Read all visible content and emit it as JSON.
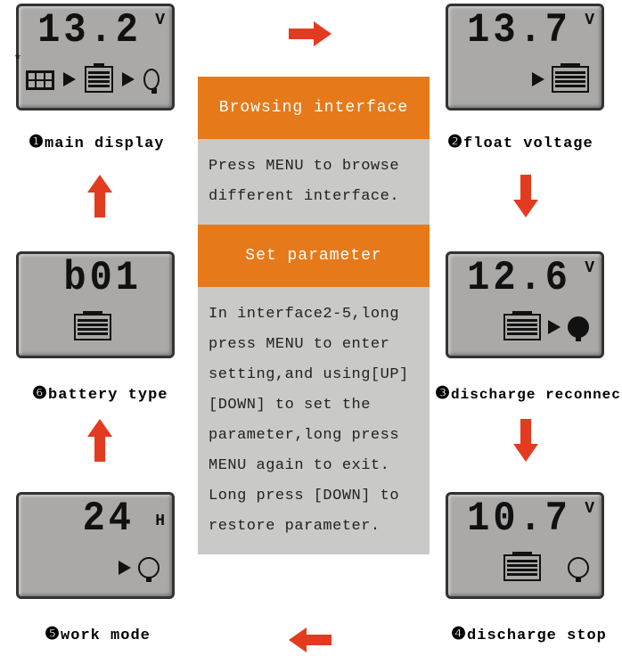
{
  "screens": {
    "main": {
      "value": "13.2",
      "unit": "V",
      "caption_num": "❶",
      "caption": "main display"
    },
    "float": {
      "value": "13.7",
      "unit": "V",
      "caption_num": "❷",
      "caption": "float voltage"
    },
    "reconnect": {
      "value": "12.6",
      "unit": "V",
      "caption_num": "❸",
      "caption": "discharge reconnect"
    },
    "stop": {
      "value": "10.7",
      "unit": "V",
      "caption_num": "❹",
      "caption": "discharge stop"
    },
    "work": {
      "value": "24",
      "unit": "H",
      "caption_num": "❺",
      "caption": "work mode"
    },
    "btype": {
      "value": "b01",
      "unit": "",
      "caption_num": "❻",
      "caption": "battery type"
    }
  },
  "center": {
    "browse_title": "Browsing interface",
    "browse_body": "Press MENU to browse different interface.",
    "set_title": "Set parameter",
    "set_body": "In interface2-5,long press MENU to enter setting,and using[UP][DOWN] to set the parameter,long press MENU again to exit. Long press [DOWN] to restore parameter."
  },
  "colors": {
    "accent": "#e67a1a",
    "arrow": "#e33b1f",
    "lcd": "#aaa9a7"
  }
}
